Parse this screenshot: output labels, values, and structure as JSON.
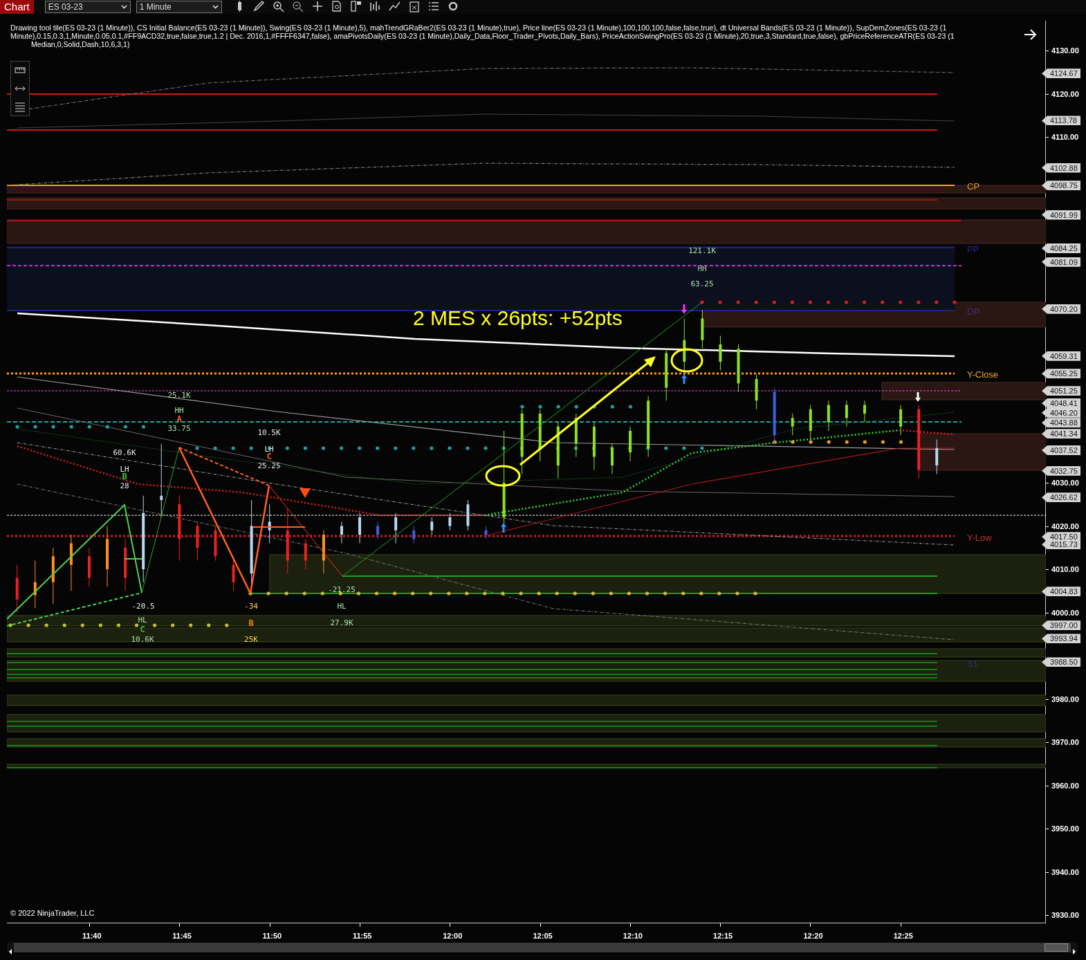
{
  "toolbar": {
    "title": "Chart",
    "instrument": "ES 03-23",
    "interval": "1 Minute"
  },
  "indicator_legend": [
    "Drawing tool tile(ES 03-23 (1 Minute)), CS Initial Balance(ES 03-23 (1 Minute)), Swing(ES 03-23 (1 Minute),5), mahTrendGRaBer2(ES 03-23 (1 Minute),true), Price line(ES 03-23 (1 Minute),100,100,100,false,false,true), dt Universal Bands(ES 03-23 (1 Minute)), SupDemZones(ES 03-23 (1",
    "Minute),0.15,0.3,1,Minute,0.05,0.1,#FF9ACD32,true,false,true,1.2 | Dec. 2016,1,#FFFF6347,false), amaPivotsDaily(ES 03-23 (1 Minute),Daily_Data,Floor_Trader_Pivots,Daily_Bars), PriceActionSwingPro(ES 03-23 (1 Minute),20,true,3,Standard,true,false), gbPriceReferenceATR(ES 03-23 (1",
    "Median,0,Solid,Dash,10,6,3,1)"
  ],
  "chart": {
    "annotation": "2 MES x 26pts: +52pts",
    "swing_labels": [
      {
        "text": "121.1K",
        "kind": "volume",
        "color": "#a8e0a8"
      },
      {
        "text": "HH",
        "kind": "swing",
        "color": "#a0c8a0"
      },
      {
        "text": "63.25",
        "kind": "points",
        "color": "#a8e0a8"
      },
      {
        "text": "25.1K",
        "kind": "volume",
        "color": "#a8e0a8"
      },
      {
        "text": "HH",
        "kind": "swing",
        "color": "#a8e0a8"
      },
      {
        "text": "A",
        "kind": "letter",
        "color": "#ff6020"
      },
      {
        "text": "33.75",
        "kind": "points",
        "color": "#a8e0a8"
      },
      {
        "text": "10.5K",
        "kind": "volume",
        "color": "#e8e8e8"
      },
      {
        "text": "LH",
        "kind": "swing",
        "color": "#e8e8e8"
      },
      {
        "text": "C",
        "kind": "letter",
        "color": "#ff6020"
      },
      {
        "text": "25.25",
        "kind": "points",
        "color": "#e8e8e8"
      },
      {
        "text": "60.6K",
        "kind": "volume",
        "color": "#e8e8e8"
      },
      {
        "text": "LH",
        "kind": "swing",
        "color": "#e8e8e8"
      },
      {
        "text": "B",
        "kind": "letter",
        "color": "#40c040"
      },
      {
        "text": "28",
        "kind": "points",
        "color": "#e8e8e8"
      },
      {
        "text": "-20.5",
        "kind": "points",
        "color": "#e8e8e8"
      },
      {
        "text": "-34",
        "kind": "points",
        "color": "#ffd040"
      },
      {
        "text": "-21.25",
        "kind": "points",
        "color": "#a8e0a8"
      },
      {
        "text": "HL",
        "kind": "swing",
        "color": "#a8e0a8"
      },
      {
        "text": "HL",
        "kind": "swing",
        "color": "#a8e0a8"
      },
      {
        "text": "C",
        "kind": "letter",
        "color": "#40c040"
      },
      {
        "text": "B",
        "kind": "letter",
        "color": "#ff8000"
      },
      {
        "text": "27.9K",
        "kind": "volume",
        "color": "#a8e0a8"
      },
      {
        "text": "10.6K",
        "kind": "volume",
        "color": "#a8e0a8"
      },
      {
        "text": "25K",
        "kind": "volume",
        "color": "#ffd040"
      }
    ],
    "level_labels": [
      {
        "text": "CP",
        "color": "#e0a020"
      },
      {
        "text": "PP",
        "color": "#28288a"
      },
      {
        "text": "DP",
        "color": "#4a2a80"
      },
      {
        "text": "Y-Close",
        "color": "#f0a030"
      },
      {
        "text": "Y-Low",
        "color": "#c83030"
      },
      {
        "text": "S1",
        "color": "#303078"
      }
    ],
    "copyright": "© 2022 NinjaTrader, LLC"
  },
  "price_axis": {
    "ticks": [
      "4130.00",
      "4120.00",
      "4110.00",
      "4030.00",
      "4020.00",
      "4010.00",
      "4000.00",
      "3980.00",
      "3970.00",
      "3960.00",
      "3950.00",
      "3940.00",
      "3930.00"
    ],
    "markers": [
      "4124.67",
      "4113.78",
      "4102.88",
      "4098.75",
      "4091.99",
      "4084.25",
      "4081.09",
      "4070.20",
      "4059.31",
      "4055.25",
      "4051.25",
      "4048.41",
      "4046.20",
      "4043.88",
      "4041.34",
      "4037.52",
      "4032.75",
      "4026.62",
      "4017.50",
      "4015.73",
      "4004.83",
      "3997.00",
      "3993.94",
      "3988.50"
    ]
  },
  "time_axis": [
    "11:40",
    "11:45",
    "11:50",
    "11:55",
    "12:00",
    "12:05",
    "12:10",
    "12:15",
    "12:20",
    "12:25"
  ]
}
